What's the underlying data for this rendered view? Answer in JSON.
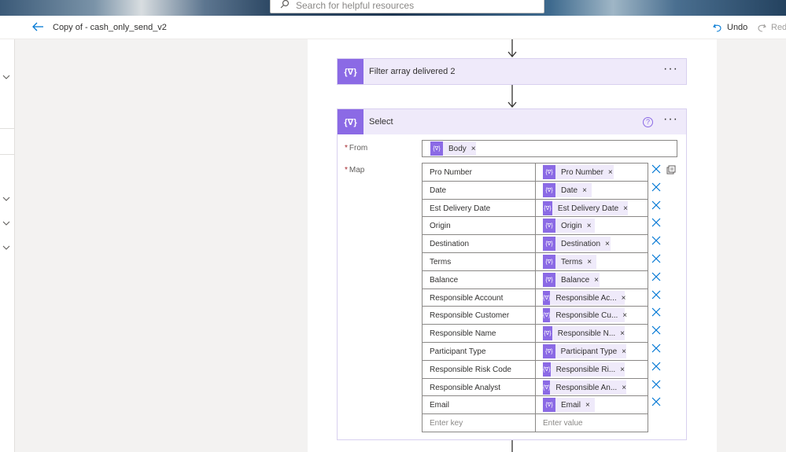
{
  "search": {
    "placeholder": "Search for helpful resources"
  },
  "header": {
    "flow_title": "Copy of - cash_only_send_v2",
    "undo_label": "Undo",
    "redo_label": "Red"
  },
  "actions": {
    "filter": {
      "title": "Filter array delivered 2",
      "icon": "{∇}",
      "more": "···"
    },
    "select": {
      "title": "Select",
      "icon": "{∇}",
      "more": "···",
      "help": "?",
      "from_label": "From",
      "map_label": "Map",
      "from_token": "Body",
      "key_placeholder": "Enter key",
      "value_placeholder": "Enter value",
      "rows": [
        {
          "key": "Pro Number",
          "value": "Pro Number"
        },
        {
          "key": "Date",
          "value": "Date"
        },
        {
          "key": "Est Delivery Date",
          "value": "Est Delivery Date"
        },
        {
          "key": "Origin",
          "value": "Origin"
        },
        {
          "key": "Destination",
          "value": "Destination"
        },
        {
          "key": "Terms",
          "value": "Terms"
        },
        {
          "key": "Balance",
          "value": "Balance"
        },
        {
          "key": "Responsible Account",
          "value": "Responsible Ac..."
        },
        {
          "key": "Responsible Customer",
          "value": "Responsible Cu..."
        },
        {
          "key": "Responsible Name",
          "value": "Responsible N..."
        },
        {
          "key": "Participant Type",
          "value": "Participant Type"
        },
        {
          "key": "Responsible Risk Code",
          "value": "Responsible Ri..."
        },
        {
          "key": "Responsible Analyst",
          "value": "Responsible An..."
        },
        {
          "key": "Email",
          "value": "Email"
        }
      ]
    }
  },
  "token_glyph": "{∇}",
  "remove_glyph": "×",
  "colors": {
    "accent": "#8b6ae5",
    "header_bg": "#efeafa",
    "link_blue": "#0078d4"
  }
}
